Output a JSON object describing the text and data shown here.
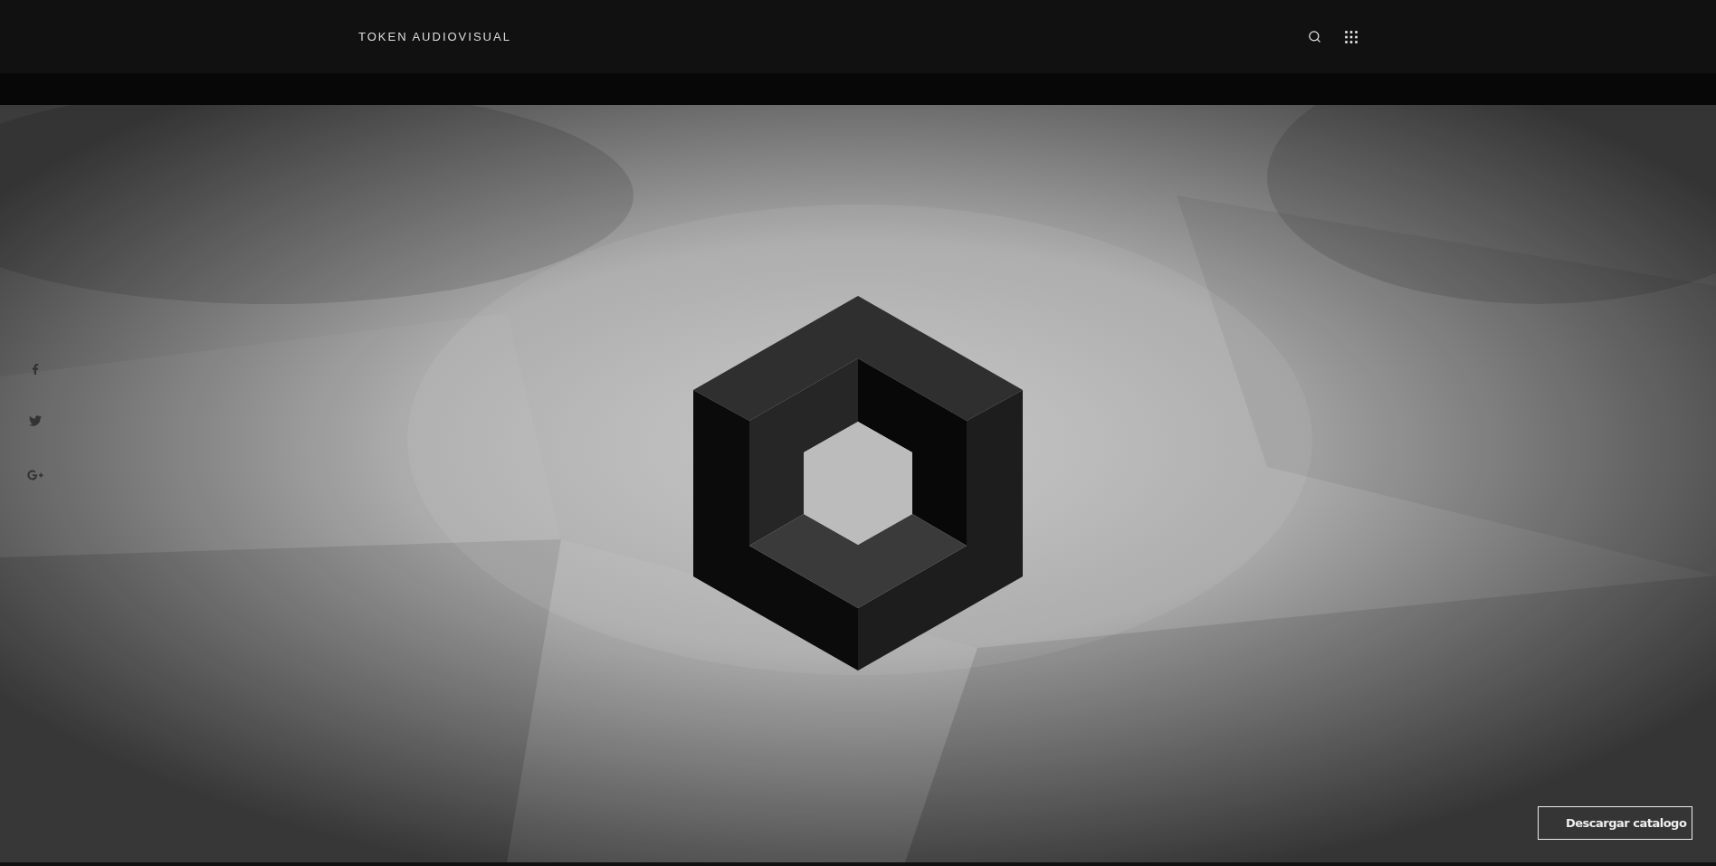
{
  "header": {
    "brand": "TOKEN AUDIOVISUAL"
  },
  "hero": {
    "kind": "picture",
    "button": "Descargar catalogo"
  }
}
